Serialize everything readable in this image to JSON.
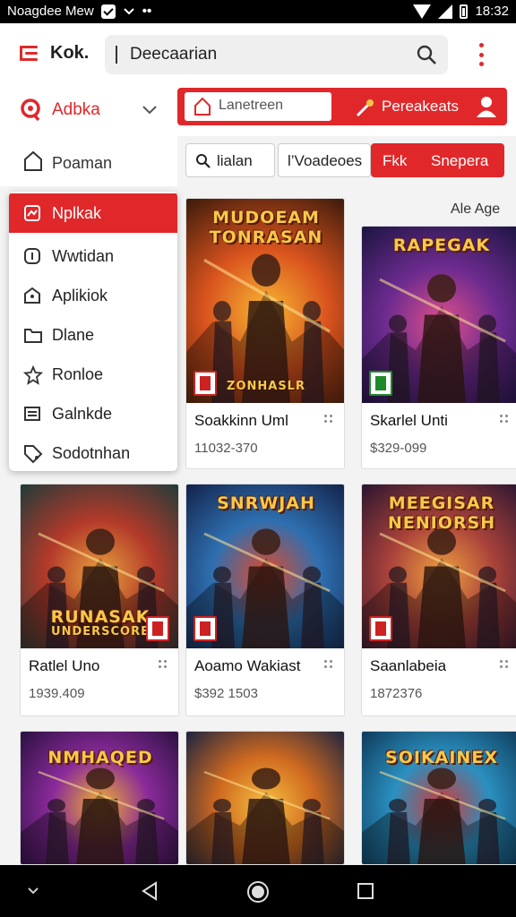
{
  "status_bar": {
    "left_text": "Noagdee Mew",
    "time": "18:32"
  },
  "app": {
    "title": "Kok."
  },
  "search": {
    "value": "Deecaarian"
  },
  "account": {
    "label": "Adbka"
  },
  "red_group": {
    "input_label": "Lanetreen",
    "button_label": "Pereakeats"
  },
  "sidebar": {
    "top_item": "Poaman",
    "items": [
      {
        "label": "Nplkak",
        "icon": "grid-icon",
        "active": true
      },
      {
        "label": "Wwtidan",
        "icon": "info-icon",
        "active": false
      },
      {
        "label": "Aplikiok",
        "icon": "shield-icon",
        "active": false
      },
      {
        "label": "Dlane",
        "icon": "folder-icon",
        "active": false
      },
      {
        "label": "Ronloe",
        "icon": "star-icon",
        "active": false
      },
      {
        "label": "Galnkde",
        "icon": "list-icon",
        "active": false
      },
      {
        "label": "Sodotnhan",
        "icon": "tag-icon",
        "active": false
      }
    ]
  },
  "filters": {
    "search_chip": "lialan",
    "chip2": "l’Voadeoes",
    "chip3": "Fkk",
    "chip4": "Snepera"
  },
  "sort_label": "Ale Age",
  "cards": [
    {
      "art_title": "MUDOEAM TONRASAN",
      "art_subtitle": "ZONHASLR",
      "title": "Soakkinn Uml",
      "price": "11032-370",
      "colors": [
        "#3a1a0a",
        "#d9531e",
        "#f7b733"
      ],
      "badge": true
    },
    {
      "art_title": "RAPEGAK",
      "art_subtitle": "",
      "title": "Skarlel Unti",
      "price": "$329-099",
      "colors": [
        "#1b1440",
        "#6d2b8f",
        "#e0508a"
      ],
      "badge": true
    },
    {
      "art_title": "RUNASAK",
      "art_subtitle": "UNDERSCORE",
      "title": "Ratlel Uno",
      "price": "1939.409",
      "colors": [
        "#1f3b3a",
        "#b33a2a",
        "#e8a23c"
      ],
      "badge": true
    },
    {
      "art_title": "SNRWJAH",
      "art_subtitle": "",
      "title": "Aoamo Wakiast",
      "price": "$392 1503",
      "colors": [
        "#13224a",
        "#2e6fb0",
        "#e04a2a"
      ],
      "badge": true
    },
    {
      "art_title": "MEEGISAR NENIORSH",
      "art_subtitle": "",
      "title": "Saanlabeia",
      "price": "1872376",
      "colors": [
        "#2a1530",
        "#a8413a",
        "#f0a040"
      ],
      "badge": true
    },
    {
      "art_title": "NMHAQED",
      "art_subtitle": "",
      "title": "",
      "price": "",
      "colors": [
        "#2a1040",
        "#8a2a9a",
        "#f0b030"
      ],
      "badge": false
    },
    {
      "art_title": "",
      "art_subtitle": "",
      "title": "",
      "price": "",
      "colors": [
        "#1b2440",
        "#d06a20",
        "#f6c040"
      ],
      "badge": false
    },
    {
      "art_title": "SOIKAINEX",
      "art_subtitle": "",
      "title": "",
      "price": "",
      "colors": [
        "#0f3a5a",
        "#2a90c0",
        "#d03a3a"
      ],
      "badge": false
    }
  ],
  "colors": {
    "accent": "#e0282b",
    "background": "#f3f3f3",
    "nav_bar": "#000000"
  }
}
